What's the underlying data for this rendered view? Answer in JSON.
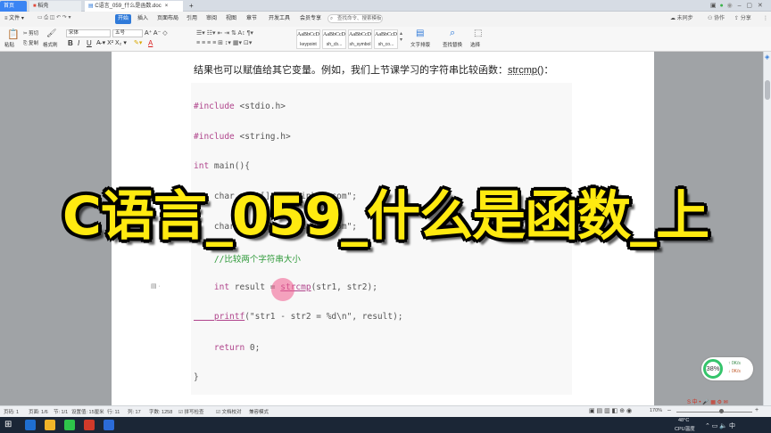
{
  "tabs": {
    "home": "首页",
    "docer": "稻壳",
    "doc": "C语言_059_什么是函数.doc",
    "add": "+"
  },
  "menu": {
    "file": "文件",
    "items": [
      "开始",
      "插入",
      "页面布局",
      "引用",
      "审阅",
      "视图",
      "章节",
      "开发工具",
      "会员专享"
    ],
    "search_placeholder": "查找命令、搜索模板",
    "right": [
      "未同步",
      "协作",
      "分享"
    ]
  },
  "ribbon": {
    "paste": "粘贴",
    "cut": "剪切",
    "copy": "复制",
    "format_painter": "格式刷",
    "font_name": "宋体",
    "font_size": "五号",
    "bold": "B",
    "italic": "I",
    "underline": "U",
    "font_color": "A",
    "styles": [
      {
        "preview": "AaBbCcDd",
        "name": "keypoint"
      },
      {
        "preview": "AaBbCcDd",
        "name": "sh_cb..."
      },
      {
        "preview": "AaBbCcDd",
        "name": "sh_symbol"
      },
      {
        "preview": "AaBbCcDd",
        "name": "sh_co..."
      }
    ],
    "text_layout": "文字排版",
    "find_replace": "查找替换",
    "select": "选择"
  },
  "document": {
    "intro_pre": "结果也可以赋值给其它变量。例如，我们上节课学习的字符串比较函数：",
    "intro_fn": "strcmp()",
    "intro_post": "：",
    "code": {
      "include1_kw": "#include",
      "include1_hdr": " <stdio.h>",
      "include2_kw": "#include",
      "include2_hdr": " <string.h>",
      "main_kw": "int",
      "main_rest": " main(){",
      "line_str1": "    char str1[] = \"apipkes.com\";",
      "line_str2": "    char str2[] = \"apipkes.com\";",
      "comment": "    //比较两个字符串大小",
      "result_kw": "    int",
      "result_mid": " result = ",
      "result_fn": "strcmp",
      "result_rest": "(str1, str2);",
      "printf_fn": "    printf",
      "printf_str": "(\"str1 - str2 = %d\\n\"",
      "printf_rest": ", result);",
      "return_kw": "    return",
      "return_rest": " 0;",
      "close": "}"
    }
  },
  "overlay_title": "C语言_059_什么是函数_上",
  "status": {
    "page": "页码: 1",
    "pages": "页面: 1/6",
    "section": "节: 1/1",
    "setting": "设置值: 15厘米",
    "row": "行: 11",
    "col": "列: 17",
    "words": "字数: 1258",
    "spell": "拼写检查",
    "doc_check": "文档校对",
    "compat": "兼容模式",
    "zoom": "170%"
  },
  "speed_widget": {
    "percent": "38%",
    "up": "0K/s",
    "down": "0K/s"
  },
  "tray": {
    "temp": "48°C",
    "cpu": "CPU温度",
    "time": "中",
    "lang": "中"
  },
  "colors": {
    "accent": "#3a84f3",
    "title_yellow": "#ffea10",
    "keyword": "#b0458c",
    "comment": "#2f9a3a",
    "string": "#d4722a"
  }
}
